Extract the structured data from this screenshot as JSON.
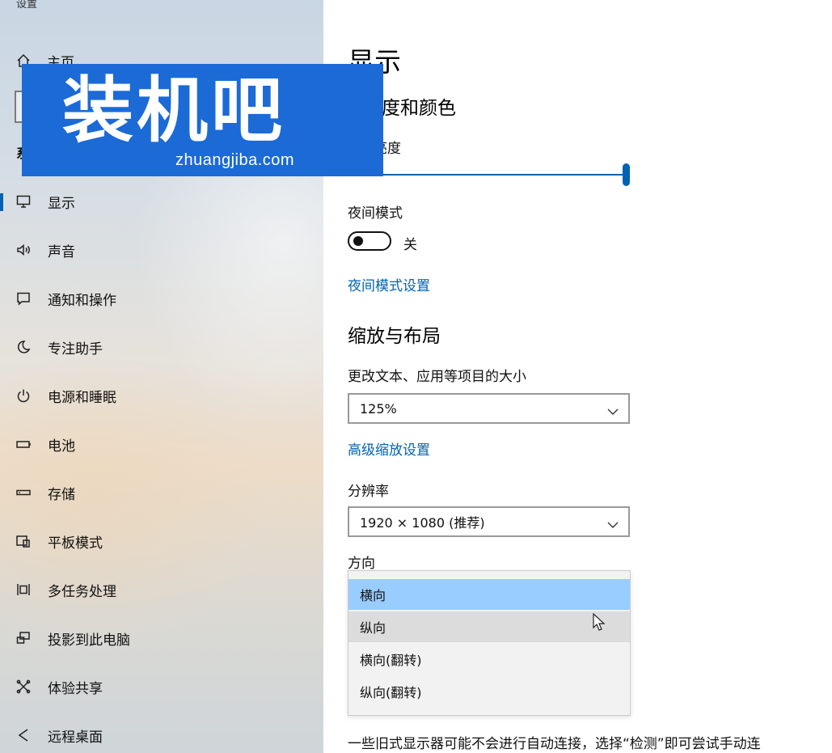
{
  "window": {
    "app_title": "设置"
  },
  "sidebar": {
    "home_label": "主页",
    "section_label": "系",
    "items": [
      {
        "label": "显示",
        "icon": "monitor-icon",
        "active": true
      },
      {
        "label": "声音",
        "icon": "speaker-icon"
      },
      {
        "label": "通知和操作",
        "icon": "notification-icon"
      },
      {
        "label": "专注助手",
        "icon": "moon-icon"
      },
      {
        "label": "电源和睡眠",
        "icon": "power-icon"
      },
      {
        "label": "电池",
        "icon": "battery-icon"
      },
      {
        "label": "存储",
        "icon": "storage-icon"
      },
      {
        "label": "平板模式",
        "icon": "tablet-icon"
      },
      {
        "label": "多任务处理",
        "icon": "multitask-icon"
      },
      {
        "label": "投影到此电脑",
        "icon": "project-icon"
      },
      {
        "label": "体验共享",
        "icon": "share-icon"
      },
      {
        "label": "远程桌面",
        "icon": "remote-desktop-icon"
      }
    ]
  },
  "watermark": {
    "main": "装机吧",
    "sub": "zhuangjiba.com"
  },
  "main": {
    "title": "显示",
    "brightness_heading": "度和颜色",
    "brightness_label": "亮度",
    "night_mode_label": "夜间模式",
    "night_mode_state": "关",
    "night_mode_link": "夜间模式设置",
    "scale_heading": "缩放与布局",
    "text_size_label": "更改文本、应用等项目的大小",
    "scale_value": "125%",
    "advanced_scale_link": "高级缩放设置",
    "resolution_label": "分辨率",
    "resolution_value": "1920 × 1080 (推荐)",
    "orientation_label": "方向",
    "orientation_options": [
      "横向",
      "纵向",
      "横向(翻转)",
      "纵向(翻转)"
    ],
    "note": "一些旧式显示器可能不会进行自动连接，选择“检测”即可尝试手动连"
  },
  "colors": {
    "accent": "#0063b1",
    "selected_option": "#99ccff",
    "watermark_bg": "#1b6ad6"
  }
}
